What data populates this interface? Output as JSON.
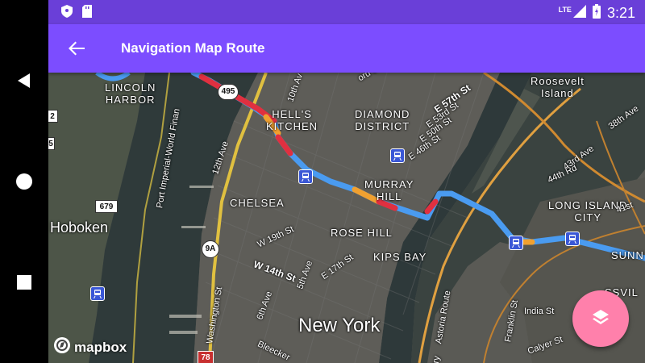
{
  "status_bar": {
    "time": "3:21",
    "network": "LTE",
    "icons": [
      "shield-icon",
      "sd-card-icon",
      "signal-icon",
      "battery-icon"
    ]
  },
  "nav_bar": {
    "icons": [
      "back-triangle-icon",
      "home-circle-icon",
      "recents-square-icon"
    ]
  },
  "app_bar": {
    "title": "Navigation Map Route",
    "back_icon": "arrow-back-icon",
    "color": "#7c4dff"
  },
  "map": {
    "attribution": "mapbox",
    "neighborhoods": {
      "lincoln_harbor": "LINCOLN\nHARBOR",
      "hells_kitchen": "HELL'S\nKITCHEN",
      "diamond_district": "DIAMOND\nDISTRICT",
      "murray_hill": "MURRAY\nHILL",
      "chelsea": "CHELSEA",
      "rose_hill": "ROSE HILL",
      "kips_bay": "KIPS BAY",
      "roosevelt_island": "Roosevelt\nIsland",
      "long_island_city": "LONG ISLAND\nCITY",
      "hoboken": "Hoboken",
      "new_york": "New York",
      "sunn": "SUNN",
      "ssvil": "SSVIL"
    },
    "streets": {
      "tenth_ave": "10th Av",
      "twelfth_ave": "12th Ave",
      "e_57th": "E 57th St",
      "e_53rd": "E 53rd St",
      "e_50th": "E 50th St",
      "e_46th": "E 46th St",
      "w_19th": "W 19th St",
      "w_14th": "W 14th St",
      "fifth_ave": "5th Ave",
      "e_17th": "E 17th St",
      "sixth_ave": "6th Ave",
      "washington": "Washington St",
      "astoria": "Astoria Route",
      "port_imperial": "Port Imperial-World Finan",
      "ord_st": "ord St",
      "forty_fourth": "44th Rd",
      "forty_third": "43rd Ave",
      "thirty_eighth": "38th Ave",
      "forty_first": "41st",
      "franklin": "Franklin St",
      "india": "India St",
      "calyer": "Calyer St",
      "bleecker": "Bleecker",
      "ry_left": "rry",
      "ry_bottom": "rry"
    },
    "shields": {
      "i495": "495",
      "r679": "679",
      "r9a": "9A",
      "i78": "78",
      "edge_2": "2",
      "edge_5": "5"
    },
    "route_colors": {
      "primary": "#4a9bf0",
      "moderate": "#f0a030",
      "heavy": "#e03040"
    },
    "layers_fab_icon": "layers-icon",
    "fab_color": "#ff80ab"
  }
}
